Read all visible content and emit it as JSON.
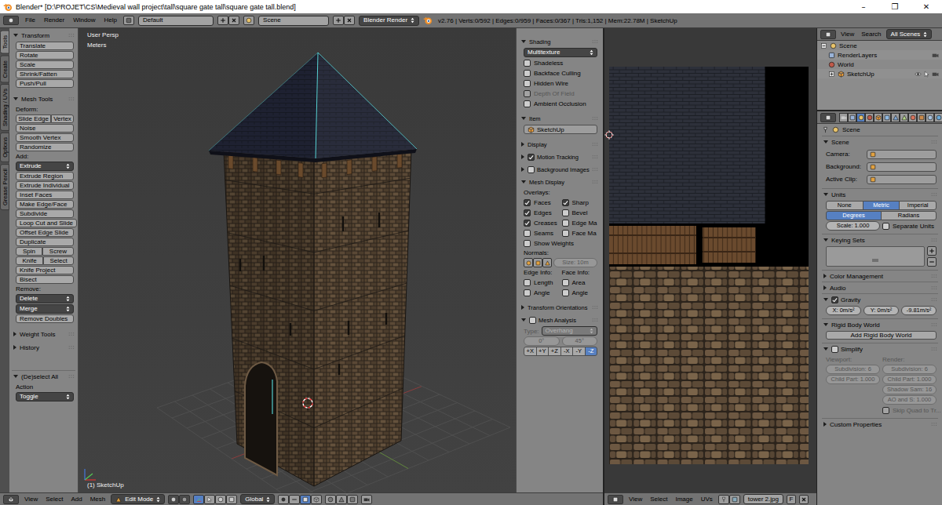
{
  "window": {
    "title": "Blender* [D:\\PROJET\\CS\\Medieval wall project\\tall\\square gate tall\\square gate tall.blend]",
    "controls": [
      "–",
      "❐",
      "✕"
    ]
  },
  "info_header": {
    "menus": [
      "File",
      "Render",
      "Window",
      "Help"
    ],
    "layout": "Default",
    "scene": "Scene",
    "engine": "Blender Render",
    "stats": "v2.76 | Verts:0/592 | Edges:0/959 | Faces:0/367 | Tris:1,152 | Mem:22.78M | SketchUp"
  },
  "tool_shelf": {
    "tabs": [
      {
        "label": "Tools",
        "selected": true
      },
      {
        "label": "Create",
        "selected": false
      },
      {
        "label": "Shading / UVs",
        "selected": false
      },
      {
        "label": "Options",
        "selected": false
      },
      {
        "label": "Grease Pencil",
        "selected": false
      }
    ],
    "panels": [
      {
        "title": "Transform",
        "expanded": true,
        "items": [
          {
            "kind": "buttons",
            "labels": [
              "Translate"
            ]
          },
          {
            "kind": "buttons",
            "labels": [
              "Rotate"
            ]
          },
          {
            "kind": "buttons",
            "labels": [
              "Scale"
            ]
          },
          {
            "kind": "buttons",
            "labels": [
              "Shrink/Fatten"
            ]
          },
          {
            "kind": "buttons",
            "labels": [
              "Push/Pull"
            ]
          }
        ]
      },
      {
        "title": "Mesh Tools",
        "expanded": true,
        "items": [
          {
            "kind": "label",
            "text": "Deform:"
          },
          {
            "kind": "buttons",
            "labels": [
              "Slide Edge",
              "Vertex"
            ]
          },
          {
            "kind": "buttons",
            "labels": [
              "Noise"
            ]
          },
          {
            "kind": "buttons",
            "labels": [
              "Smooth Vertex"
            ]
          },
          {
            "kind": "buttons",
            "labels": [
              "Randomize"
            ]
          },
          {
            "kind": "label",
            "text": "Add:"
          },
          {
            "kind": "menu",
            "text": "Extrude",
            "disabled": false
          },
          {
            "kind": "buttons",
            "labels": [
              "Extrude Region"
            ]
          },
          {
            "kind": "buttons",
            "labels": [
              "Extrude Individual"
            ]
          },
          {
            "kind": "buttons",
            "labels": [
              "Inset Faces"
            ]
          },
          {
            "kind": "buttons",
            "labels": [
              "Make Edge/Face"
            ]
          },
          {
            "kind": "buttons",
            "labels": [
              "Subdivide"
            ]
          },
          {
            "kind": "buttons",
            "labels": [
              "Loop Cut and Slide"
            ]
          },
          {
            "kind": "buttons",
            "labels": [
              "Offset Edge Slide"
            ]
          },
          {
            "kind": "buttons",
            "labels": [
              "Duplicate"
            ]
          },
          {
            "kind": "buttons",
            "labels": [
              "Spin",
              "Screw"
            ]
          },
          {
            "kind": "buttons",
            "labels": [
              "Knife",
              "Select"
            ]
          },
          {
            "kind": "buttons",
            "labels": [
              "Knife Project"
            ]
          },
          {
            "kind": "buttons",
            "labels": [
              "Bisect"
            ]
          },
          {
            "kind": "label",
            "text": "Remove:"
          },
          {
            "kind": "menu",
            "text": "Delete",
            "disabled": false
          },
          {
            "kind": "menu",
            "text": "Merge",
            "disabled": false
          },
          {
            "kind": "buttons",
            "labels": [
              "Remove Doubles"
            ]
          }
        ]
      },
      {
        "title": "Weight Tools",
        "expanded": false,
        "items": []
      },
      {
        "title": "History",
        "expanded": false,
        "items": []
      }
    ],
    "operator": {
      "title": "(De)select All",
      "expanded": true,
      "items": [
        {
          "kind": "label",
          "text": "Action"
        },
        {
          "kind": "menu",
          "text": "Toggle",
          "disabled": false
        }
      ]
    }
  },
  "viewport": {
    "view_name": "User Persp",
    "units": "Meters",
    "object_label": "(1) SketchUp"
  },
  "view3d_header": {
    "menus": [
      "View",
      "Select",
      "Add",
      "Mesh"
    ],
    "mode": "Edit Mode",
    "orientation": "Global"
  },
  "n_panel": {
    "sections": [
      {
        "title": "Shading",
        "expanded": true,
        "checkbox": null,
        "items": [
          {
            "kind": "menu",
            "text": "Multitexture",
            "disabled": false
          },
          {
            "kind": "check",
            "label": "Shadeless",
            "checked": false,
            "disabled": false
          },
          {
            "kind": "check",
            "label": "Backface Culling",
            "checked": false,
            "disabled": false
          },
          {
            "kind": "check",
            "label": "Hidden Wire",
            "checked": false,
            "disabled": false
          },
          {
            "kind": "check",
            "label": "Depth Of Field",
            "checked": false,
            "disabled": true
          },
          {
            "kind": "check",
            "label": "Ambient Occlusion",
            "checked": false,
            "disabled": false
          }
        ]
      },
      {
        "title": "Item",
        "expanded": true,
        "checkbox": null,
        "items": [
          {
            "kind": "field",
            "text": "SketchUp"
          }
        ]
      },
      {
        "title": "Display",
        "expanded": false,
        "checkbox": null,
        "items": []
      },
      {
        "title": "Motion Tracking",
        "expanded": false,
        "checkbox": true,
        "items": []
      },
      {
        "title": "Background Images",
        "expanded": false,
        "checkbox": false,
        "items": []
      },
      {
        "title": "Mesh Display",
        "expanded": true,
        "checkbox": null,
        "items": [
          {
            "kind": "label",
            "text": "Overlays:"
          },
          {
            "kind": "checkgrid",
            "cells": [
              {
                "label": "Faces",
                "checked": true
              },
              {
                "label": "Sharp",
                "checked": true
              }
            ]
          },
          {
            "kind": "checkgrid",
            "cells": [
              {
                "label": "Edges",
                "checked": true
              },
              {
                "label": "Bevel",
                "checked": false
              }
            ]
          },
          {
            "kind": "checkgrid",
            "cells": [
              {
                "label": "Creases",
                "checked": true
              },
              {
                "label": "Edge Ma",
                "checked": false
              }
            ]
          },
          {
            "kind": "checkgrid",
            "cells": [
              {
                "label": "Seams",
                "checked": false
              },
              {
                "label": "Face Ma",
                "checked": false
              }
            ]
          },
          {
            "kind": "check",
            "label": "Show Weights",
            "checked": false,
            "disabled": false
          },
          {
            "kind": "label",
            "text": "Normals:"
          },
          {
            "kind": "normals",
            "text": "Size: 10m",
            "disabled": true
          },
          {
            "kind": "labelpair",
            "texts": [
              "Edge Info:",
              "Face Info:"
            ],
            "disabled": false
          },
          {
            "kind": "checkgrid",
            "cells": [
              {
                "label": "Length",
                "checked": false
              },
              {
                "label": "Area",
                "checked": false
              }
            ]
          },
          {
            "kind": "checkgrid",
            "cells": [
              {
                "label": "Angle",
                "checked": false
              },
              {
                "label": "Angle",
                "checked": false
              }
            ]
          }
        ]
      },
      {
        "title": "Transform Orientations",
        "expanded": false,
        "checkbox": null,
        "items": []
      },
      {
        "title": "Mesh Analysis",
        "expanded": true,
        "checkbox": false,
        "items": [
          {
            "kind": "typerow",
            "label": "Type:",
            "text": "Overhang",
            "disabled": true
          },
          {
            "kind": "numpair",
            "values": [
              "0°",
              "45°"
            ],
            "disabled": true
          },
          {
            "kind": "axes",
            "axes": [
              {
                "label": "+X",
                "selected": false
              },
              {
                "label": "+Y",
                "selected": false
              },
              {
                "label": "+Z",
                "selected": false
              },
              {
                "label": "-X",
                "selected": false
              },
              {
                "label": "-Y",
                "selected": false
              },
              {
                "label": "-Z",
                "selected": true
              }
            ]
          }
        ]
      }
    ]
  },
  "image_editor": {
    "menus": [
      "View",
      "Select",
      "Image",
      "UVs"
    ],
    "image_name": "tower 2.jpg",
    "fake_user": "F"
  },
  "outliner": {
    "menus": [
      "View",
      "Search"
    ],
    "filter": "All Scenes",
    "tree": [
      {
        "label": "Scene",
        "depth": 0,
        "expanded": true
      },
      {
        "label": "RenderLayers",
        "depth": 1,
        "expanded": null
      },
      {
        "label": "World",
        "depth": 1,
        "expanded": null
      },
      {
        "label": "SketchUp",
        "depth": 1,
        "expanded": false
      }
    ]
  },
  "properties": {
    "context_tabs": [
      {
        "selected": false
      },
      {
        "selected": false
      },
      {
        "selected": true
      },
      {
        "selected": false
      },
      {
        "selected": false
      },
      {
        "selected": false
      },
      {
        "selected": false
      },
      {
        "selected": false
      },
      {
        "selected": false
      },
      {
        "selected": false
      },
      {
        "selected": false
      },
      {
        "selected": false
      }
    ],
    "breadcrumb": "Scene",
    "sections": [
      {
        "title": "Scene",
        "expanded": true,
        "checkbox": null,
        "items": [
          {
            "kind": "fieldrow",
            "label": "Camera:"
          },
          {
            "kind": "fieldrow",
            "label": "Background:"
          },
          {
            "kind": "fieldrow",
            "label": "Active Clip:"
          }
        ]
      },
      {
        "title": "Units",
        "expanded": true,
        "checkbox": null,
        "items": [
          {
            "kind": "toggles",
            "options": [
              {
                "label": "None",
                "selected": false
              },
              {
                "label": "Metric",
                "selected": true
              },
              {
                "label": "Imperial",
                "selected": false
              }
            ]
          },
          {
            "kind": "toggles",
            "options": [
              {
                "label": "Degrees",
                "selected": true
              },
              {
                "label": "Radians",
                "selected": false
              }
            ]
          },
          {
            "kind": "numcheck",
            "text": "Scale: 1.000",
            "label": "Separate Units",
            "checked": false
          }
        ]
      },
      {
        "title": "Keying Sets",
        "expanded": true,
        "checkbox": null,
        "items": [
          {
            "kind": "list"
          }
        ]
      },
      {
        "title": "Color Management",
        "expanded": false,
        "checkbox": null,
        "items": []
      },
      {
        "title": "Audio",
        "expanded": false,
        "checkbox": null,
        "items": []
      },
      {
        "title": "Gravity",
        "expanded": true,
        "checkbox": true,
        "items": [
          {
            "kind": "numrow",
            "values": [
              "X: 0m/s²",
              "Y: 0m/s²",
              "-9.81m/s²"
            ],
            "disabled": false
          }
        ]
      },
      {
        "title": "Rigid Body World",
        "expanded": true,
        "checkbox": null,
        "items": [
          {
            "kind": "button",
            "text": "Add Rigid Body World"
          }
        ]
      },
      {
        "title": "Simplify",
        "expanded": true,
        "checkbox": false,
        "items": [
          {
            "kind": "labelpair",
            "texts": [
              "Viewport:",
              "Render:"
            ],
            "disabled": true
          },
          {
            "kind": "numpair",
            "values": [
              "Subdivision: 6",
              "Subdivision: 6"
            ],
            "disabled": true
          },
          {
            "kind": "numpair",
            "values": [
              "Child Part: 1.000",
              "Child Part: 1.000"
            ],
            "disabled": true
          },
          {
            "kind": "numright",
            "values": [
              "Shadow Sam: 16"
            ],
            "disabled": true
          },
          {
            "kind": "numright",
            "values": [
              "AO and S: 1.000"
            ],
            "disabled": true
          },
          {
            "kind": "checkright",
            "label": "Skip Quad to Tr...",
            "checked": false,
            "disabled": true
          }
        ]
      },
      {
        "title": "Custom Properties",
        "expanded": false,
        "checkbox": null,
        "items": []
      }
    ]
  }
}
